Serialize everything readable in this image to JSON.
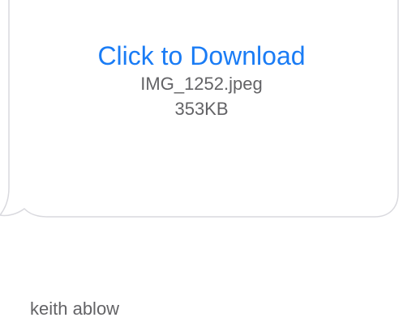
{
  "message": {
    "attachment": {
      "download_label": "Click to Download",
      "file_name": "IMG_1252.jpeg",
      "file_size": "353KB"
    },
    "bubble_color": "#ffffff",
    "bubble_border_color": "#d9d9de"
  },
  "sender": {
    "name": "keith ablow"
  },
  "colors": {
    "link": "#1a7cf5",
    "secondary_text": "#636366",
    "background": "#ffffff"
  }
}
